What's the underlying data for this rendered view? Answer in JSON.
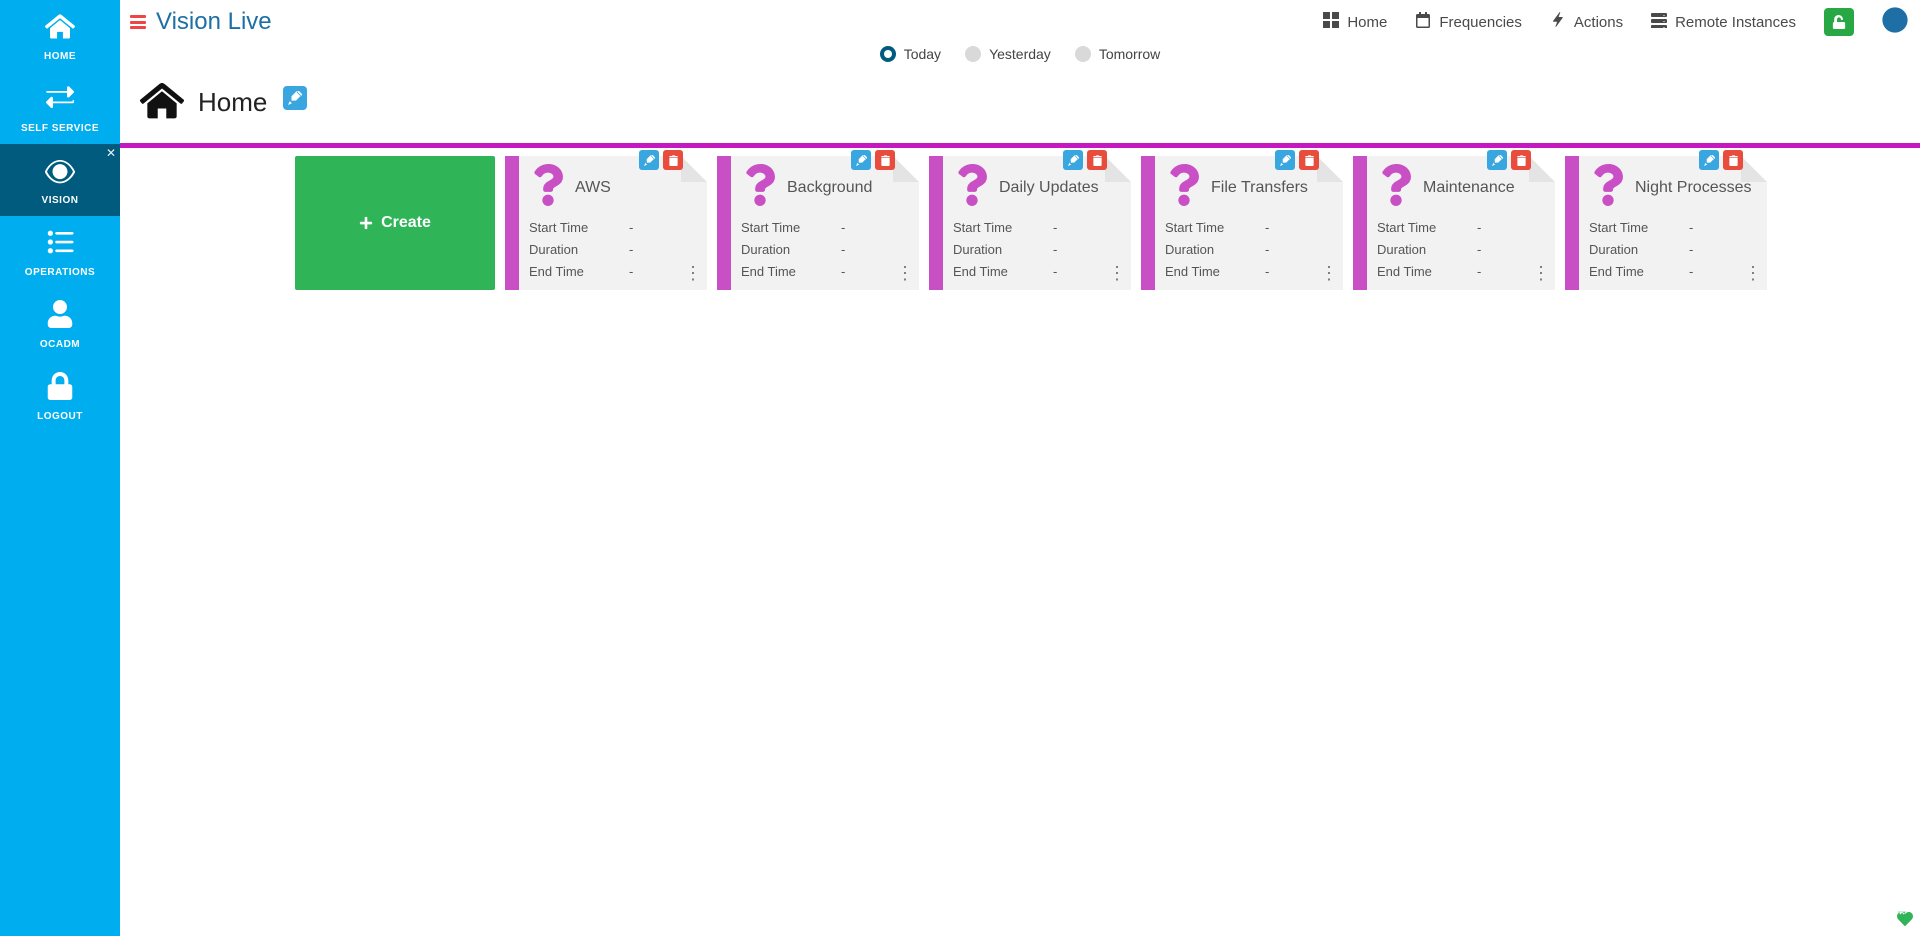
{
  "app_title": "Vision Live",
  "sidebar": {
    "items": [
      {
        "key": "home",
        "label": "HOME"
      },
      {
        "key": "selfservice",
        "label": "SELF SERVICE"
      },
      {
        "key": "vision",
        "label": "VISION"
      },
      {
        "key": "operations",
        "label": "OPERATIONS"
      },
      {
        "key": "ocadm",
        "label": "OCADM"
      },
      {
        "key": "logout",
        "label": "LOGOUT"
      }
    ]
  },
  "top_nav": {
    "home": "Home",
    "frequencies": "Frequencies",
    "actions": "Actions",
    "remote": "Remote Instances"
  },
  "day_selector": {
    "today": "Today",
    "yesterday": "Yesterday",
    "tomorrow": "Tomorrow",
    "selected": "today"
  },
  "breadcrumb": {
    "title": "Home"
  },
  "create_label": "Create",
  "card_labels": {
    "start": "Start Time",
    "duration": "Duration",
    "end": "End Time"
  },
  "cards": [
    {
      "title": "AWS",
      "start": "-",
      "duration": "-",
      "end": "-"
    },
    {
      "title": "Background",
      "start": "-",
      "duration": "-",
      "end": "-"
    },
    {
      "title": "Daily Updates",
      "start": "-",
      "duration": "-",
      "end": "-"
    },
    {
      "title": "File Transfers",
      "start": "-",
      "duration": "-",
      "end": "-"
    },
    {
      "title": "Maintenance",
      "start": "-",
      "duration": "-",
      "end": "-"
    },
    {
      "title": "Night Processes",
      "start": "-",
      "duration": "-",
      "end": "-"
    }
  ]
}
